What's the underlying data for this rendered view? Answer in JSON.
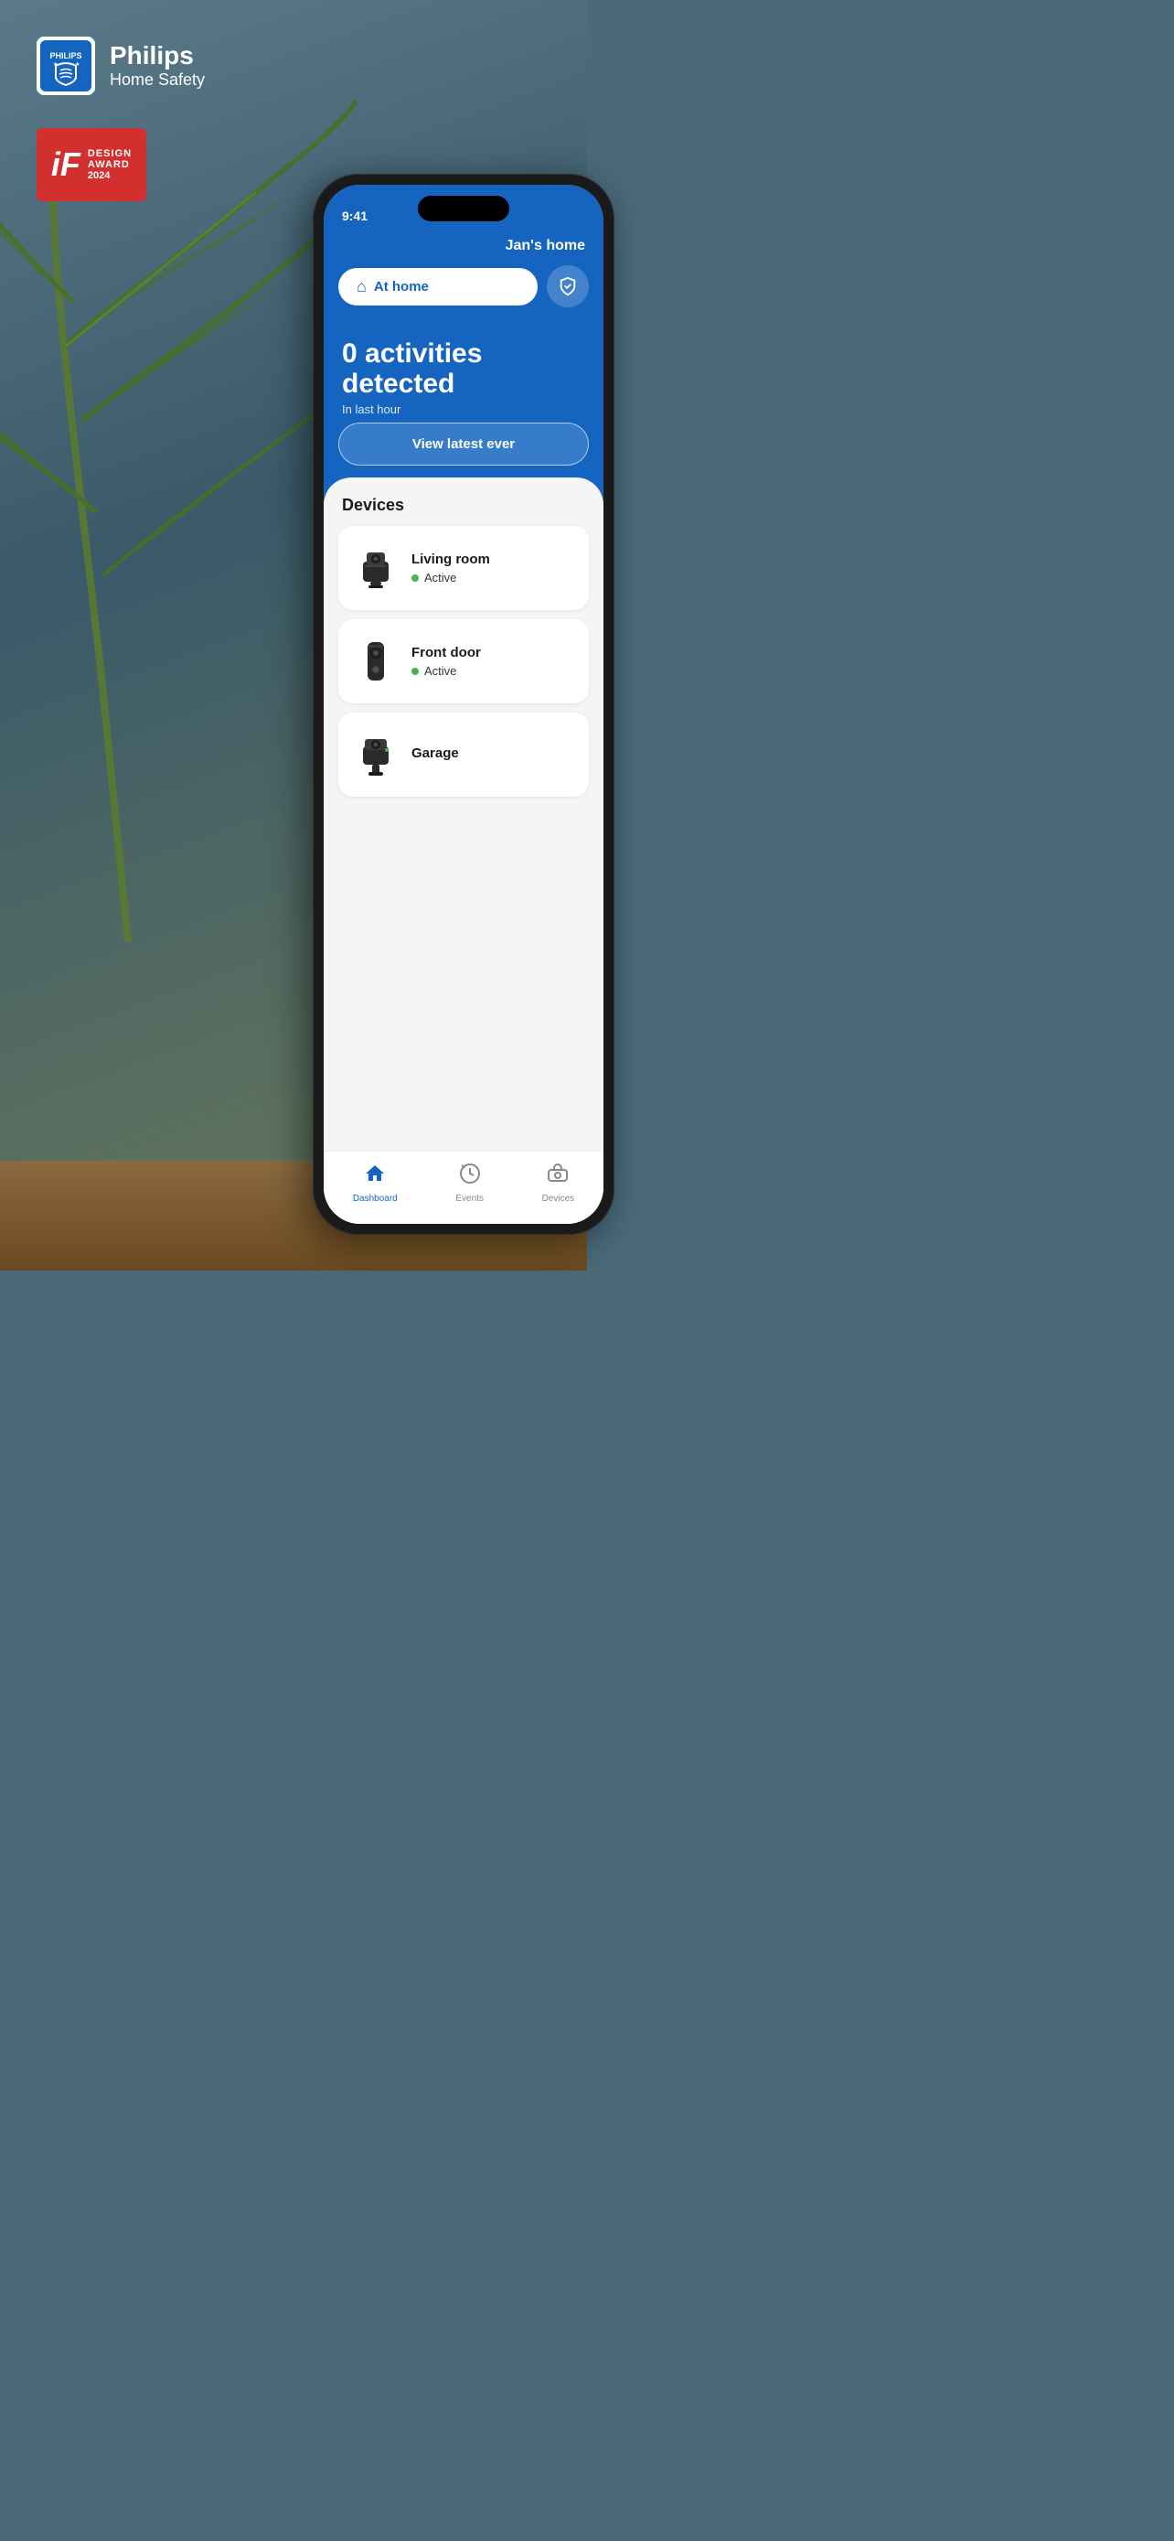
{
  "background": {
    "color": "#4a6a7a"
  },
  "branding": {
    "company": "Philips",
    "product": "Home Safety",
    "logo_alt": "Philips logo"
  },
  "award": {
    "label_i": "iF",
    "label_design": "DESIGN",
    "label_award": "AWARD",
    "label_year": "2024"
  },
  "phone": {
    "status_bar": {
      "time": "9:41"
    },
    "header": {
      "home_name": "Jan's home",
      "mode_label": "At home",
      "mode_icon": "house",
      "shield_icon": "shield-check"
    },
    "activities": {
      "count_text": "0 activities detected",
      "sub_text": "In last hour"
    },
    "view_latest_button": "View latest ever",
    "devices_section": {
      "header": "Devices",
      "items": [
        {
          "name": "Living room",
          "status": "Active",
          "type": "indoor-camera"
        },
        {
          "name": "Front door",
          "status": "Active",
          "type": "doorbell-camera"
        },
        {
          "name": "Garage",
          "status": "",
          "type": "outdoor-camera"
        }
      ]
    },
    "bottom_nav": [
      {
        "label": "Dashboard",
        "icon": "house",
        "active": true
      },
      {
        "label": "Events",
        "icon": "clock-rotate",
        "active": false
      },
      {
        "label": "Devices",
        "icon": "camera",
        "active": false
      }
    ]
  }
}
